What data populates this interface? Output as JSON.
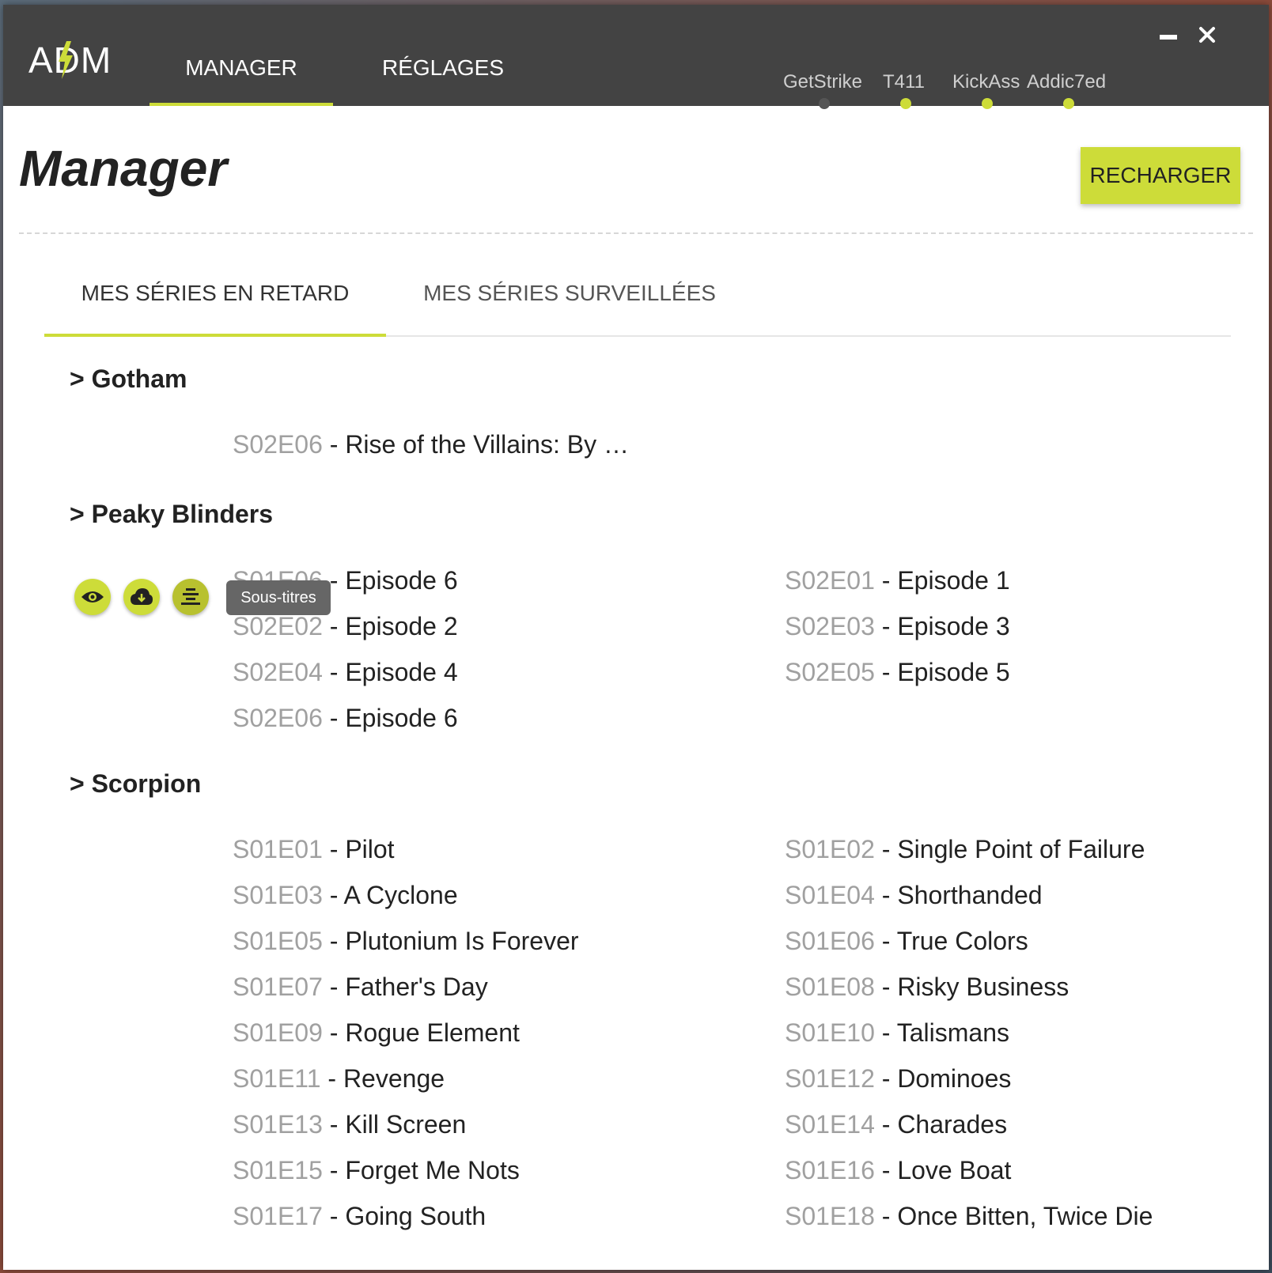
{
  "app": {
    "logo": "ADM",
    "nav_tabs": [
      "MANAGER",
      "RÉGLAGES"
    ],
    "sources": [
      {
        "name": "GetStrike",
        "status_color": "#555555"
      },
      {
        "name": "T411",
        "status_color": "#cddc39"
      },
      {
        "name": "KickAss",
        "status_color": "#cddc39"
      },
      {
        "name": "Addic7ed",
        "status_color": "#cddc39"
      }
    ],
    "window_controls": {
      "minimize": "minimize-icon",
      "close": "close-icon"
    },
    "accent_color": "#cddc39"
  },
  "page": {
    "title": "Manager",
    "reload_label": "RECHARGER",
    "subtabs": [
      "MES SÉRIES EN RETARD",
      "MES SÉRIES SURVEILLÉES"
    ]
  },
  "series": [
    {
      "title": "> Gotham",
      "episodes": [
        {
          "code": "S02E06",
          "name": "Rise of the Villains: By …"
        }
      ]
    },
    {
      "title": "> Peaky Blinders",
      "episodes": [
        {
          "code": "S01E06",
          "name": "Episode 6"
        },
        {
          "code": "S02E01",
          "name": "Episode 1"
        },
        {
          "code": "S02E02",
          "name": "Episode 2"
        },
        {
          "code": "S02E03",
          "name": "Episode 3"
        },
        {
          "code": "S02E04",
          "name": "Episode 4"
        },
        {
          "code": "S02E05",
          "name": "Episode 5"
        },
        {
          "code": "S02E06",
          "name": "Episode 6"
        }
      ]
    },
    {
      "title": "> Scorpion",
      "episodes": [
        {
          "code": "S01E01",
          "name": "Pilot"
        },
        {
          "code": "S01E02",
          "name": "Single Point of Failure"
        },
        {
          "code": "S01E03",
          "name": "A Cyclone"
        },
        {
          "code": "S01E04",
          "name": "Shorthanded"
        },
        {
          "code": "S01E05",
          "name": "Plutonium Is Forever"
        },
        {
          "code": "S01E06",
          "name": "True Colors"
        },
        {
          "code": "S01E07",
          "name": "Father's Day"
        },
        {
          "code": "S01E08",
          "name": "Risky Business"
        },
        {
          "code": "S01E09",
          "name": "Rogue Element"
        },
        {
          "code": "S01E10",
          "name": "Talismans"
        },
        {
          "code": "S01E11",
          "name": "Revenge"
        },
        {
          "code": "S01E12",
          "name": "Dominoes"
        },
        {
          "code": "S01E13",
          "name": "Kill Screen"
        },
        {
          "code": "S01E14",
          "name": "Charades"
        },
        {
          "code": "S01E15",
          "name": "Forget Me Nots"
        },
        {
          "code": "S01E16",
          "name": "Love Boat"
        },
        {
          "code": "S01E17",
          "name": "Going South"
        },
        {
          "code": "S01E18",
          "name": "Once Bitten, Twice Die"
        }
      ]
    }
  ],
  "hover_actions": {
    "icons": [
      "eye-icon",
      "cloud-download-icon",
      "subtitles-icon"
    ],
    "tooltip": "Sous-titres"
  },
  "ep_separator": " - "
}
